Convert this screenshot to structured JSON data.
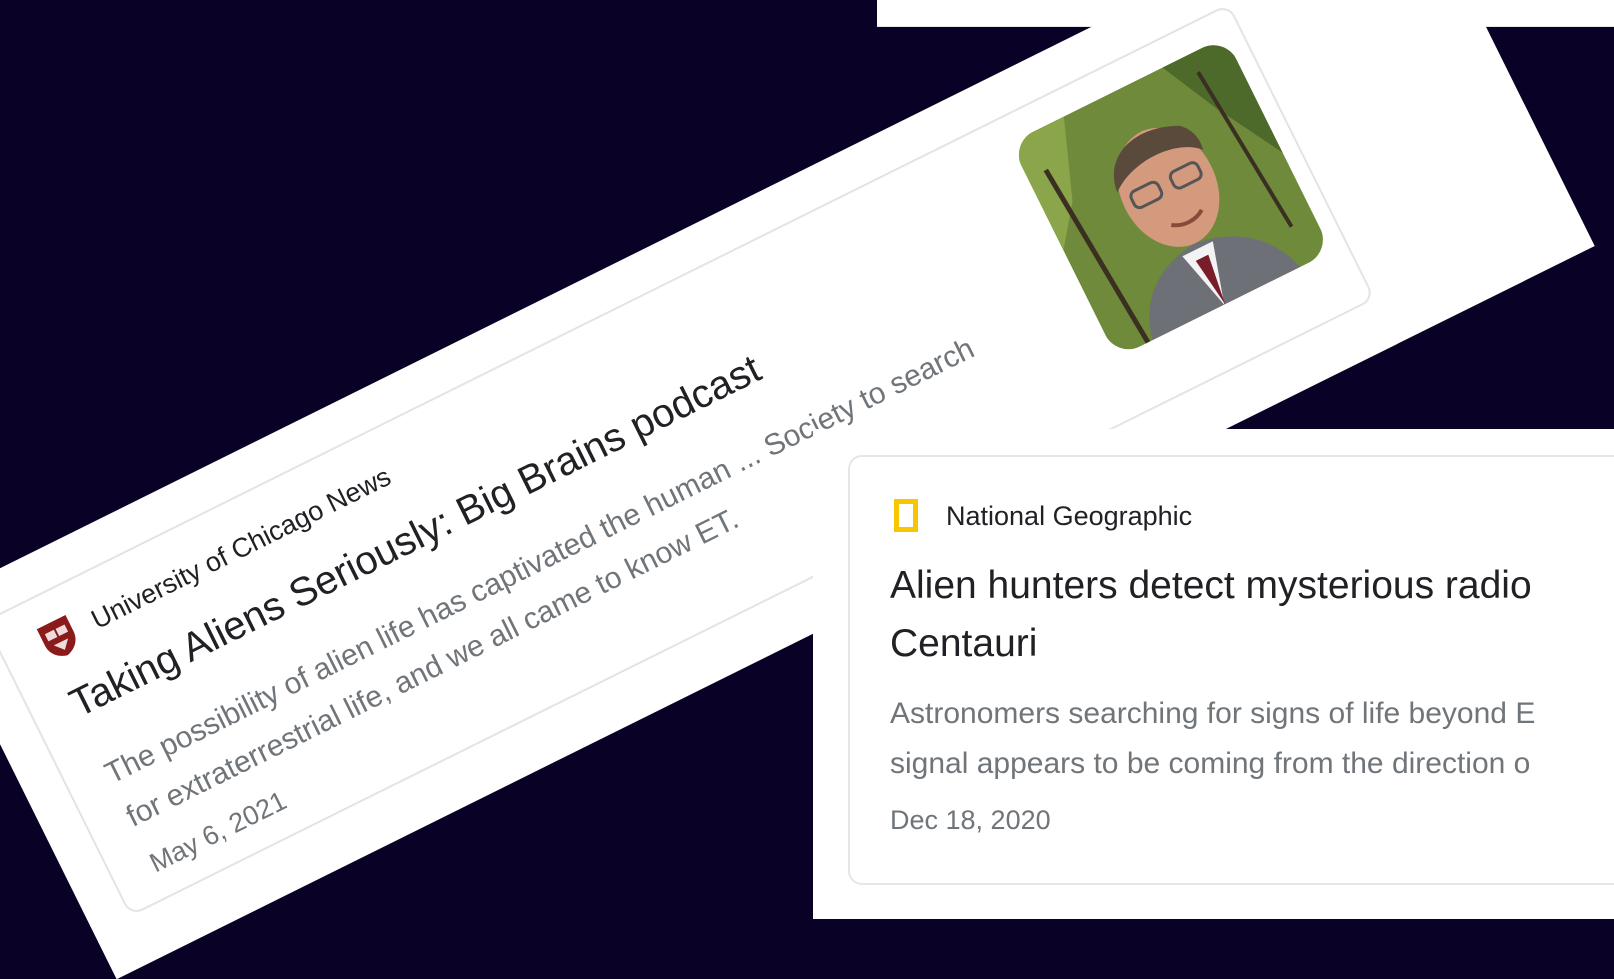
{
  "uchicago_card": {
    "source": "University of Chicago News",
    "title": "Taking Aliens Seriously: Big Brains podcast",
    "snippet": "The possibility of alien life has captivated the human ... Society to search for extraterrestrial life, and we all came to know ET.",
    "date": "May 6, 2021",
    "logo_icon": "university-shield-icon",
    "logo_color": "#8b1a1a",
    "thumbnail": "man-portrait-photo"
  },
  "natgeo_card": {
    "source": "National Geographic",
    "title": "Alien hunters detect mysterious radio\nCentauri",
    "snippet": "Astronomers searching for signs of life beyond E\nsignal appears to be coming from the direction o",
    "date": "Dec 18, 2020",
    "logo_icon": "yellow-rectangle-icon",
    "logo_color": "#f7c600"
  },
  "colors": {
    "background": "#0a0127",
    "card_border": "#e4e4e4",
    "title_text": "#202124",
    "muted_text": "#70757a"
  }
}
